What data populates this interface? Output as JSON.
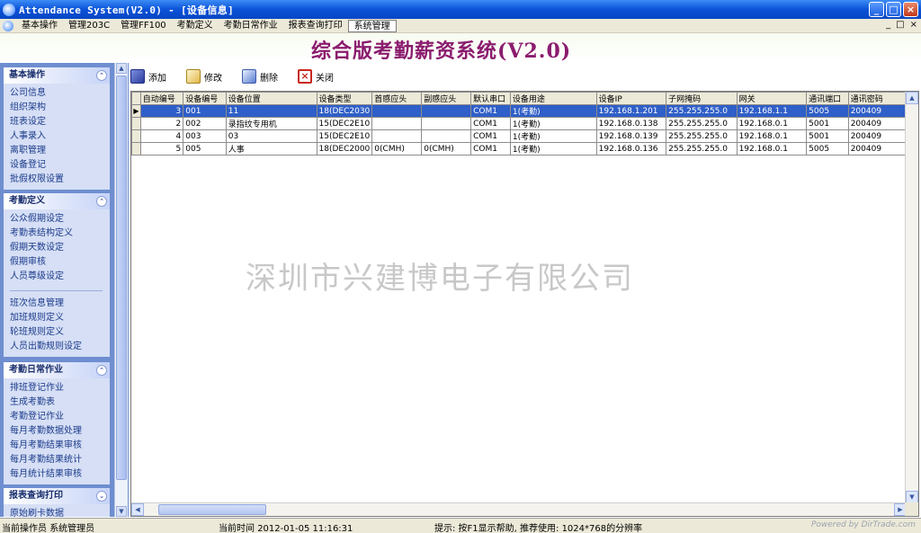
{
  "window": {
    "title": "Attendance System(V2.0) - [设备信息]",
    "minimize": "_",
    "maximize": "□",
    "close": "×"
  },
  "menubar": {
    "items": [
      "基本操作",
      "管理203C",
      "管理FF100",
      "考勤定义",
      "考勤日常作业",
      "报表查询打印",
      "系统管理"
    ],
    "active_index": 6,
    "mdi_buttons": [
      "_",
      "□",
      "×"
    ]
  },
  "banner": {
    "title": "综合版考勤薪资系统(V2.0)"
  },
  "toolbar": {
    "add": "添加",
    "edit": "修改",
    "delete": "删除",
    "close": "关闭"
  },
  "sidebar": {
    "groups": [
      {
        "title": "基本操作",
        "toggle": "⌃",
        "items": [
          "公司信息",
          "组织架构",
          "班表设定",
          "人事录入",
          "离职管理",
          "设备登记",
          "批假权限设置"
        ]
      },
      {
        "title": "考勤定义",
        "toggle": "⌃",
        "items": [
          "公众假期设定",
          "考勤表结构定义",
          "假期天数设定",
          "假期审核",
          "人员尊级设定"
        ],
        "items2": [
          "班次信息管理",
          "加班规则定义",
          "轮班规则定义",
          "人员出勤规则设定"
        ]
      },
      {
        "title": "考勤日常作业",
        "toggle": "⌃",
        "items": [
          "排班登记作业",
          "生成考勤表",
          "考勤登记作业",
          "每月考勤数据处理",
          "每月考勤结果审核",
          "每月考勤结果统计",
          "每月统计结果审核"
        ]
      },
      {
        "title": "报表查询打印",
        "toggle": "⌄",
        "items": [
          "原始刷卡数据"
        ]
      }
    ]
  },
  "grid": {
    "columns": [
      "自动编号",
      "设备编号",
      "设备位置",
      "设备类型",
      "首感应头",
      "副感应头",
      "默认串口",
      "设备用途",
      "设备IP",
      "子网掩码",
      "网关",
      "通讯端口",
      "通讯密码"
    ],
    "rows": [
      [
        "3",
        "001",
        "11",
        "18(DEC2030",
        "",
        "",
        "COM1",
        "1(考勤)",
        "192.168.1.201",
        "255.255.255.0",
        "192.168.1.1",
        "5005",
        "200409"
      ],
      [
        "2",
        "002",
        "录指纹专用机",
        "15(DEC2E10",
        "",
        "",
        "COM1",
        "1(考勤)",
        "192.168.0.138",
        "255.255.255.0",
        "192.168.0.1",
        "5001",
        "200409"
      ],
      [
        "4",
        "003",
        "03",
        "15(DEC2E10",
        "",
        "",
        "COM1",
        "1(考勤)",
        "192.168.0.139",
        "255.255.255.0",
        "192.168.0.1",
        "5001",
        "200409"
      ],
      [
        "5",
        "005",
        "人事",
        "18(DEC2000",
        "0(CMH)",
        "0(CMH)",
        "COM1",
        "1(考勤)",
        "192.168.0.136",
        "255.255.255.0",
        "192.168.0.1",
        "5005",
        "200409"
      ]
    ],
    "selected_row": 0
  },
  "watermark": "深圳市兴建博电子有限公司",
  "statusbar": {
    "operator_label": "当前操作员",
    "operator_value": "系统管理员",
    "time_label": "当前时间",
    "time_value": "2012-01-05 11:16:31",
    "hint": "提示: 按F1显示帮助, 推荐使用: 1024*768的分辨率",
    "credit": "Powered by DirTrade.com"
  }
}
